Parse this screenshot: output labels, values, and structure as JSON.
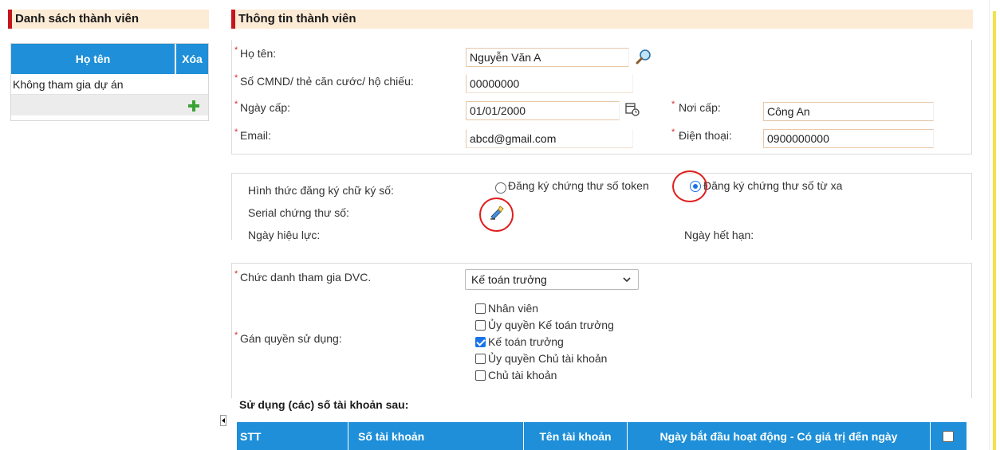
{
  "left": {
    "title": "Danh sách thành viên",
    "columns": [
      "Họ tên",
      "Xóa"
    ],
    "rows": [
      "Không tham gia dự án"
    ],
    "add_icon": "plus-icon"
  },
  "main": {
    "title": "Thông tin thành viên",
    "fields": {
      "ho_ten_label": "Họ tên:",
      "ho_ten_value": "Nguyễn Văn A",
      "cmnd_label": "Số CMND/ thẻ căn cước/ hộ chiếu:",
      "cmnd_value": "00000000",
      "ngay_cap_label": "Ngày cấp:",
      "ngay_cap_value": "01/01/2000",
      "noi_cap_label": "Nơi cấp:",
      "noi_cap_value": "Công An",
      "email_label": "Email:",
      "email_value": "abcd@gmail.com",
      "dien_thoai_label": "Điện thoại:",
      "dien_thoai_value": "0900000000"
    },
    "signature": {
      "hinh_thuc_label": "Hình thức đăng ký chữ ký số:",
      "option_token": "Đăng ký chứng thư số token",
      "option_remote": "Đăng ký chứng thư số từ xa",
      "selected": "remote",
      "serial_label": "Serial chứng thư số:",
      "ngay_hieu_luc_label": "Ngày hiệu lực:",
      "ngay_het_han_label": "Ngày hết hạn:"
    },
    "role": {
      "chuc_danh_label": "Chức danh tham gia DVC.",
      "chuc_danh_value": "Kế toán trưởng",
      "gan_quyen_label": "Gán quyền sử dụng:",
      "permissions": [
        {
          "label": "Nhân viên",
          "checked": false
        },
        {
          "label": "Ủy quyền Kế toán trưởng",
          "checked": false
        },
        {
          "label": "Kế toán trưởng",
          "checked": true
        },
        {
          "label": "Ủy quyền Chủ tài khoản",
          "checked": false
        },
        {
          "label": "Chủ tài khoản",
          "checked": false
        }
      ]
    },
    "accounts": {
      "heading": "Sử dụng (các) số tài khoản sau:",
      "columns": [
        "STT",
        "Số tài khoản",
        "Tên tài khoản",
        "Ngày bắt đầu hoạt động - Có giá trị đến ngày"
      ]
    }
  },
  "colors": {
    "header_bg": "#fcebd5",
    "accent_red": "#c4161c",
    "table_blue": "#1e8fd8",
    "highlight_circle": "#e01d1d"
  }
}
